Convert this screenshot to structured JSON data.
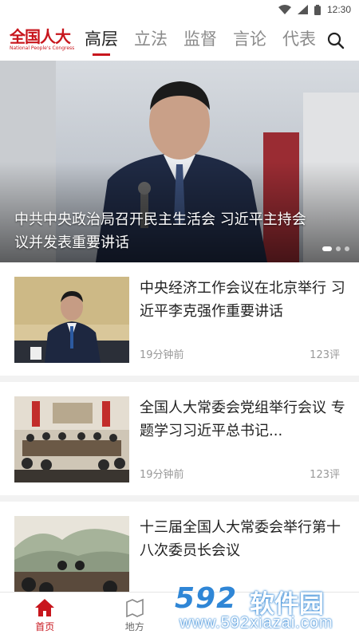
{
  "status_bar": {
    "time": "12:30"
  },
  "header": {
    "logo_title": "全国人大",
    "logo_subtitle": "National People's Congress",
    "tabs": [
      {
        "label": "高层",
        "active": true
      },
      {
        "label": "立法",
        "active": false
      },
      {
        "label": "监督",
        "active": false
      },
      {
        "label": "言论",
        "active": false
      },
      {
        "label": "代表",
        "active": false
      }
    ]
  },
  "hero": {
    "caption": "中共中央政治局召开民主生活会 习近平主持会议并发表重要讲话",
    "slide_count": 3,
    "active_slide": 1
  },
  "news": [
    {
      "title": "中央经济工作会议在北京举行 习近平李克强作重要讲话",
      "time": "19分钟前",
      "comments": "123评"
    },
    {
      "title": "全国人大常委会党组举行会议 专题学习习近平总书记...",
      "time": "19分钟前",
      "comments": "123评"
    },
    {
      "title": "十三届全国人大常委会举行第十八次委员长会议",
      "time": "",
      "comments": ""
    }
  ],
  "bottom_nav": [
    {
      "label": "首页",
      "icon": "home-icon",
      "active": true
    },
    {
      "label": "地方",
      "icon": "map-icon",
      "active": false
    },
    {
      "label": "",
      "icon": "",
      "active": false
    },
    {
      "label": "",
      "icon": "",
      "active": false
    }
  ],
  "watermark": {
    "number": "592",
    "name": "软件园",
    "url": "www.592xiazai.com"
  },
  "colors": {
    "brand_red": "#c8161d",
    "watermark_blue": "#2f86d6",
    "text_dark": "#222222",
    "text_muted": "#999999"
  }
}
